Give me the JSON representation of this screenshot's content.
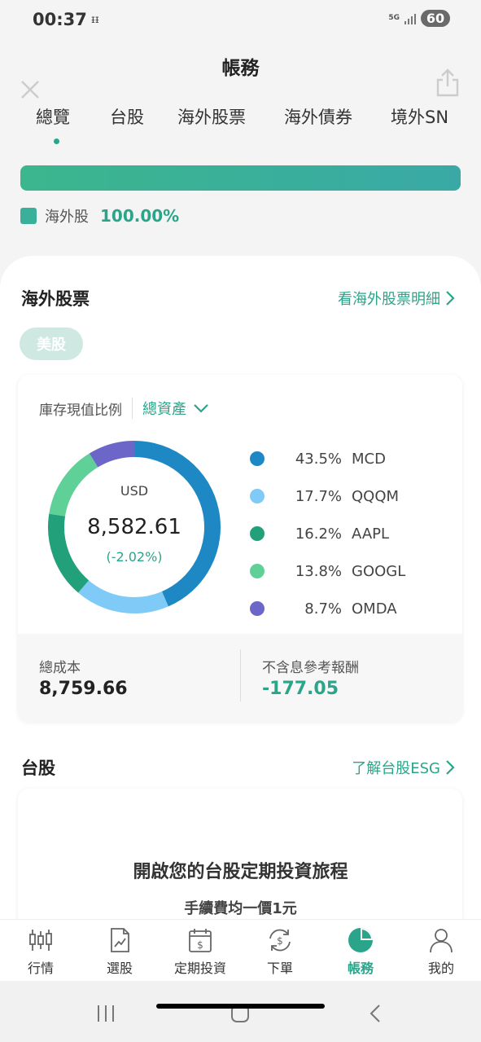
{
  "status": {
    "time": "00:37",
    "glyph": "ᵻᵻ",
    "network": "5G",
    "battery": "60"
  },
  "header": {
    "title": "帳務"
  },
  "tabs": [
    {
      "label": "總覽",
      "active": true
    },
    {
      "label": "台股",
      "active": false
    },
    {
      "label": "海外股票",
      "active": false
    },
    {
      "label": "海外債券",
      "active": false
    },
    {
      "label": "境外SN",
      "active": false
    }
  ],
  "allocation": {
    "name": "海外股",
    "percent_label": "100.00%",
    "fraction": 1.0,
    "color": "#3ab09a"
  },
  "overseas": {
    "title": "海外股票",
    "detail_link": "看海外股票明細",
    "market_chip": "美股",
    "card": {
      "ratio_label": "庫存現值比例",
      "asset_select": "總資產",
      "center": {
        "currency": "USD",
        "value": "8,582.61",
        "change": "(-2.02%)"
      },
      "cost": {
        "label": "總成本",
        "value": "8,759.66"
      },
      "return": {
        "label": "不含息參考報酬",
        "value": "-177.05"
      }
    }
  },
  "chart_data": {
    "type": "pie",
    "variant": "donut",
    "slices": [
      {
        "label": "MCD",
        "percent_label": "43.5%",
        "value": 43.5,
        "color": "#1e88c4"
      },
      {
        "label": "QQQM",
        "percent_label": "17.7%",
        "value": 17.7,
        "color": "#7fcaf7"
      },
      {
        "label": "AAPL",
        "percent_label": "16.2%",
        "value": 16.2,
        "color": "#22a07a"
      },
      {
        "label": "GOOGL",
        "percent_label": "13.8%",
        "value": 13.8,
        "color": "#5fd098"
      },
      {
        "label": "OMDA",
        "percent_label": "8.7%",
        "value": 8.7,
        "color": "#6b66c8"
      }
    ],
    "legend_placement": "right"
  },
  "taiwan": {
    "title": "台股",
    "link": "了解台股ESG",
    "headline": "開啟您的台股定期投資旅程",
    "sub": "手續費均一價1元"
  },
  "bottom_nav": [
    {
      "label": "行情",
      "icon": "candlestick-icon",
      "active": false
    },
    {
      "label": "選股",
      "icon": "stock-picker-icon",
      "active": false
    },
    {
      "label": "定期投資",
      "icon": "calendar-dollar-icon",
      "active": false
    },
    {
      "label": "下單",
      "icon": "exchange-dollar-icon",
      "active": false
    },
    {
      "label": "帳務",
      "icon": "pie-chart-icon",
      "active": true
    },
    {
      "label": "我的",
      "icon": "profile-icon",
      "active": false
    }
  ],
  "colors": {
    "accent": "#2aa58a",
    "negative": "#2aa58a"
  }
}
